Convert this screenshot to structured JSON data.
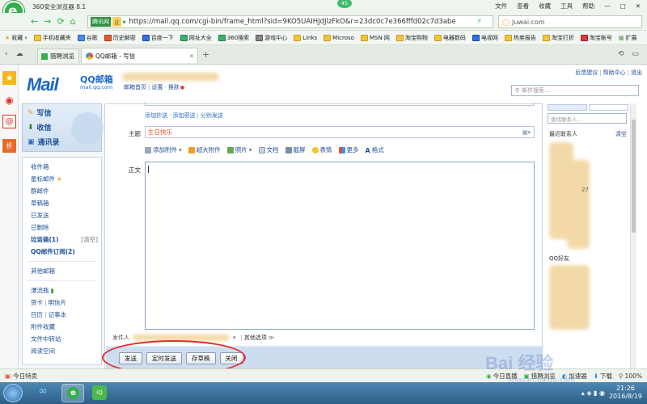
{
  "browser": {
    "title": "360安全浏览器 8.1",
    "badge": "45",
    "menu": [
      "文件",
      "查看",
      "收藏",
      "工具",
      "帮助"
    ],
    "site_label": "腾讯网",
    "cert_label": "证",
    "url": "https://mail.qq.com/cgi-bin/frame_html?sid=9KO5UAIHJdJlzFkO&r=23dc0c7e366fffd02c7d3abe",
    "search_placeholder": "Juwai.com",
    "favorites": {
      "root": "收藏",
      "items": [
        "手机收藏夹",
        "谷歌",
        "历史解密",
        "百度一下",
        "网址大全",
        "360搜索",
        "游戏中心",
        "Links",
        "Microso",
        "MSN 网",
        "淘宝购物",
        "电器数码",
        "电视网",
        "热卖报告",
        "淘宝打折",
        "淘宝帐号"
      ],
      "more": "扩展"
    },
    "tabs": [
      {
        "label": "猎聘浏览"
      },
      {
        "label": "QQ邮箱 - 写信"
      }
    ],
    "new_tab": "+"
  },
  "mail_header": {
    "logo_text": "Mail",
    "brand": "QQ邮箱",
    "domain": "mail.qq.com",
    "home_link": "邮箱首页",
    "settings_link": "设置",
    "switch_link": "换肤",
    "feedback": "反馈建议",
    "help": "帮助中心",
    "logout": "退出",
    "search_placeholder": "邮件搜索..."
  },
  "nav": {
    "write": "写信",
    "receive": "收信",
    "contacts": "通讯录",
    "folders": [
      {
        "label": "收件箱"
      },
      {
        "label": "星标邮件"
      },
      {
        "label": "群邮件"
      },
      {
        "label": "草稿箱"
      },
      {
        "label": "已发送"
      },
      {
        "label": "已删除"
      }
    ],
    "spam": "垃圾箱(1)",
    "clear": "[清空]",
    "subscription": "QQ邮件订阅(2)",
    "other_mailbox": "其他邮箱",
    "drift": "漂流瓶",
    "card": "贺卡",
    "postcard": "明信片",
    "calendar": "日历",
    "notes": "记事本",
    "attachments": "附件收藏",
    "transfer": "文件中转站",
    "reading": "阅读空间"
  },
  "compose": {
    "recipient_links": [
      "添加抄送",
      "添加密送",
      "分别发送"
    ],
    "subject_label": "主题",
    "subject_value": "生日快乐",
    "toolbar": [
      "添加附件",
      "超大附件",
      "照片",
      "文档",
      "截屏",
      "表情",
      "更多",
      "格式"
    ],
    "body_label": "正文",
    "sender_label": "发件人",
    "other_options": "其他选项",
    "buttons": {
      "send": "发送",
      "timed_send": "定时发送",
      "save_draft": "存草稿",
      "close": "关闭"
    }
  },
  "contacts_panel": {
    "tabs": [
      "通讯录",
      "QQ"
    ],
    "search_placeholder": "查找联系人...",
    "recent_label": "最近联系人",
    "clear": "清空",
    "partial_number": "27",
    "qq_friends": "QQ好友"
  },
  "statusbar": {
    "left": "今日特卖",
    "live": "今日直播",
    "browse_mode": "猎聘浏览",
    "accelerator": "加速器",
    "download": "下载",
    "zoom": "100%"
  },
  "taskbar": {
    "time": "21:26",
    "date": "2016/8/19"
  },
  "watermark": {
    "brand": "Bai 经验",
    "url": "jingyan.baidu.com"
  },
  "colors": {
    "browser_green": "#31b14a",
    "mail_blue": "#1d4f99",
    "nav_bg": "#dbe7f5",
    "subject_red": "#e0532a",
    "button_bar": "#cdddf0",
    "annotation_red": "#e32a2a"
  }
}
